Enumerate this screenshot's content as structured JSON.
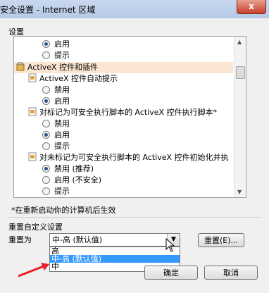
{
  "window": {
    "title": "安全设置 - Internet 区域",
    "close_label": "x"
  },
  "settings_label": "设置",
  "tree": [
    {
      "kind": "radio",
      "label": "启用",
      "checked": true
    },
    {
      "kind": "radio",
      "label": "提示",
      "checked": false
    },
    {
      "kind": "category",
      "label": "ActiveX 控件和插件"
    },
    {
      "kind": "setting",
      "label": "ActiveX 控件自动提示"
    },
    {
      "kind": "radio",
      "label": "禁用",
      "checked": false
    },
    {
      "kind": "radio",
      "label": "启用",
      "checked": true
    },
    {
      "kind": "setting",
      "label": "对标记为可安全执行脚本的 ActiveX 控件执行脚本*"
    },
    {
      "kind": "radio",
      "label": "禁用",
      "checked": false
    },
    {
      "kind": "radio",
      "label": "启用",
      "checked": true
    },
    {
      "kind": "radio",
      "label": "提示",
      "checked": false
    },
    {
      "kind": "setting",
      "label": "对未标记为可安全执行脚本的 ActiveX 控件初始化并执"
    },
    {
      "kind": "radio",
      "label": "禁用 (推荐)",
      "checked": true
    },
    {
      "kind": "radio",
      "label": "启用 (不安全)",
      "checked": false
    },
    {
      "kind": "radio",
      "label": "提示",
      "checked": false
    }
  ],
  "note": "*在重新启动你的计算机后生效",
  "reset": {
    "group_label": "重置自定义设置",
    "reset_to_label": "重置为",
    "selected": "中-高 (默认值)",
    "options": [
      "高",
      "中-高 (默认值)",
      "中"
    ],
    "highlighted_index": 1,
    "reset_button": "重置(E)..."
  },
  "buttons": {
    "ok": "确定",
    "cancel": "取消"
  },
  "colors": {
    "category_highlight": "#fbe6d3",
    "selection": "#3399ff",
    "annotation_arrow": "#e8202a"
  }
}
